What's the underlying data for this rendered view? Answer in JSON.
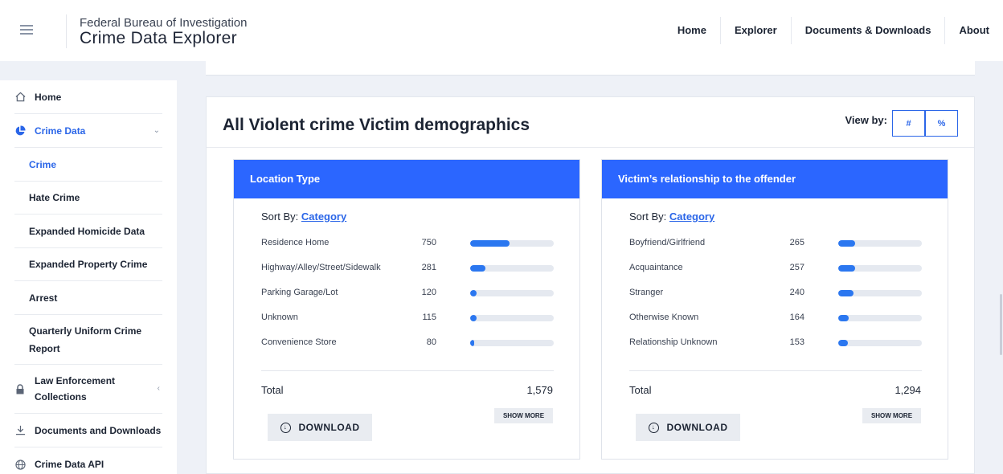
{
  "header": {
    "org": "Federal Bureau of Investigation",
    "app": "Crime Data Explorer",
    "nav": [
      "Home",
      "Explorer",
      "Documents & Downloads",
      "About"
    ]
  },
  "sidebar": {
    "items": [
      {
        "label": "Home",
        "icon": "home-icon"
      },
      {
        "label": "Crime Data",
        "icon": "pie-chart-icon"
      },
      {
        "label": "Crime"
      },
      {
        "label": "Hate Crime"
      },
      {
        "label": "Expanded Homicide Data"
      },
      {
        "label": "Expanded Property Crime"
      },
      {
        "label": "Arrest"
      },
      {
        "label": "Quarterly Uniform Crime Report"
      },
      {
        "label": "Law Enforcement Collections",
        "icon": "lock-icon"
      },
      {
        "label": "Documents and Downloads",
        "icon": "download-icon"
      },
      {
        "label": "Crime Data API",
        "icon": "globe-icon"
      }
    ]
  },
  "main": {
    "title": "All Violent crime Victim demographics",
    "view_by_label": "View by:",
    "view_by_options": [
      "#",
      "%"
    ],
    "colors": {
      "accent": "#2b66ff",
      "bar": "#2b77f0",
      "track": "#e5e9f0"
    },
    "panels": [
      {
        "title": "Location Type",
        "sort_label": "Sort By:",
        "sort_value": "Category",
        "rows": [
          {
            "label": "Residence Home",
            "value": "750",
            "fraction": 0.475
          },
          {
            "label": "Highway/Alley/Street/Sidewalk",
            "value": "281",
            "fraction": 0.178
          },
          {
            "label": "Parking Garage/Lot",
            "value": "120",
            "fraction": 0.076
          },
          {
            "label": "Unknown",
            "value": "115",
            "fraction": 0.073
          },
          {
            "label": "Convenience Store",
            "value": "80",
            "fraction": 0.051
          }
        ],
        "total_label": "Total",
        "total_value": "1,579",
        "download_label": "DOWNLOAD",
        "show_more_label": "SHOW MORE"
      },
      {
        "title": "Victim’s relationship to the offender",
        "sort_label": "Sort By:",
        "sort_value": "Category",
        "rows": [
          {
            "label": "Boyfriend/Girlfriend",
            "value": "265",
            "fraction": 0.205
          },
          {
            "label": "Acquaintance",
            "value": "257",
            "fraction": 0.199
          },
          {
            "label": "Stranger",
            "value": "240",
            "fraction": 0.185
          },
          {
            "label": "Otherwise Known",
            "value": "164",
            "fraction": 0.127
          },
          {
            "label": "Relationship Unknown",
            "value": "153",
            "fraction": 0.118
          }
        ],
        "total_label": "Total",
        "total_value": "1,294",
        "download_label": "DOWNLOAD",
        "show_more_label": "SHOW MORE"
      }
    ]
  }
}
